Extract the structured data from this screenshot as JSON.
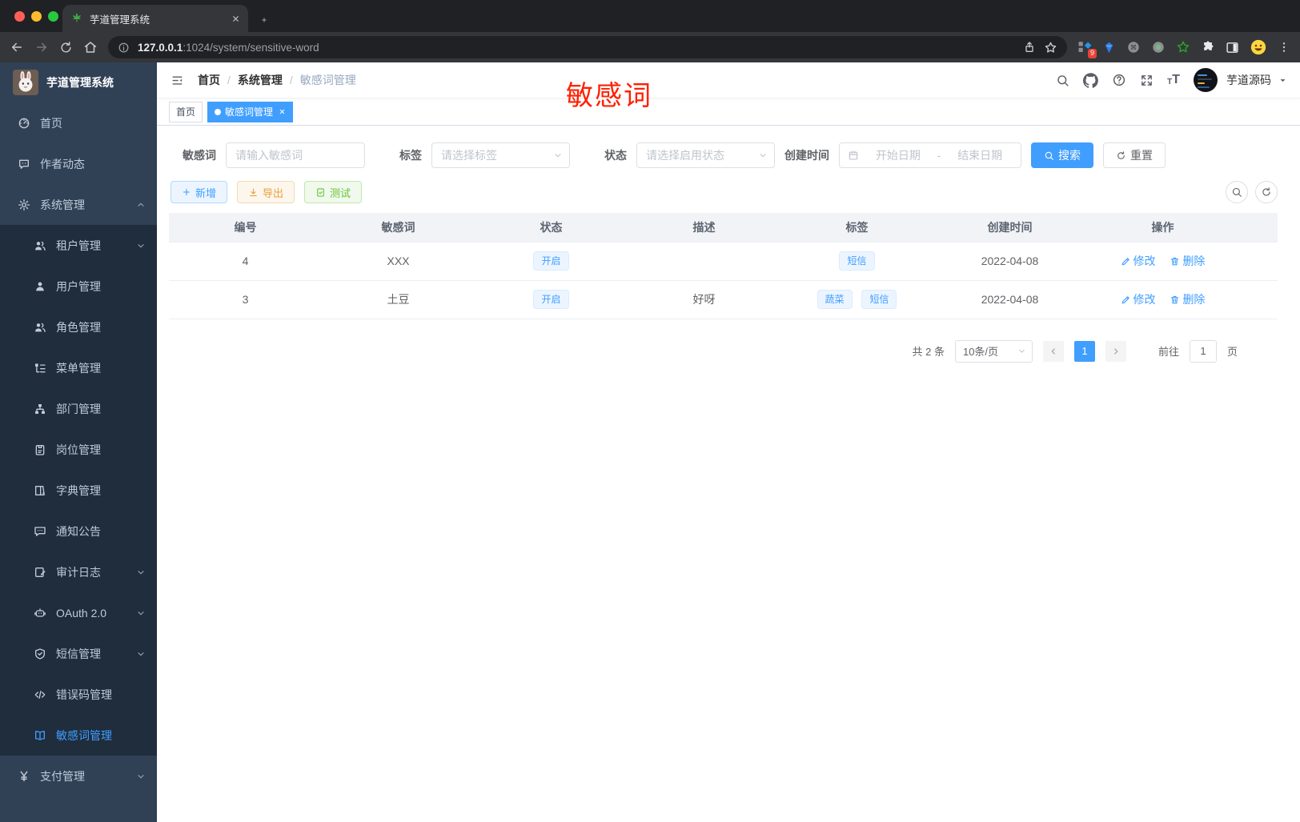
{
  "browser": {
    "tab_title": "芋道管理系统",
    "url_host": "127.0.0.1",
    "url_rest": ":1024/system/sensitive-word",
    "ext_badge": "9"
  },
  "sidebar": {
    "logo_title": "芋道管理系统",
    "items": [
      {
        "label": "首页"
      },
      {
        "label": "作者动态"
      },
      {
        "label": "系统管理"
      },
      {
        "label": "租户管理"
      },
      {
        "label": "用户管理"
      },
      {
        "label": "角色管理"
      },
      {
        "label": "菜单管理"
      },
      {
        "label": "部门管理"
      },
      {
        "label": "岗位管理"
      },
      {
        "label": "字典管理"
      },
      {
        "label": "通知公告"
      },
      {
        "label": "审计日志"
      },
      {
        "label": "OAuth 2.0"
      },
      {
        "label": "短信管理"
      },
      {
        "label": "错误码管理"
      },
      {
        "label": "敏感词管理"
      },
      {
        "label": "支付管理"
      }
    ]
  },
  "navbar": {
    "breadcrumbs": [
      "首页",
      "系统管理",
      "敏感词管理"
    ],
    "username": "芋道源码"
  },
  "tabs": [
    {
      "label": "首页"
    },
    {
      "label": "敏感词管理"
    }
  ],
  "annotation": {
    "text": "敏感词",
    "color": "#ff2000"
  },
  "filters": {
    "keyword_label": "敏感词",
    "keyword_placeholder": "请输入敏感词",
    "tag_label": "标签",
    "tag_placeholder": "请选择标签",
    "status_label": "状态",
    "status_placeholder": "请选择启用状态",
    "date_label": "创建时间",
    "date_start_placeholder": "开始日期",
    "date_sep": "-",
    "date_end_placeholder": "结束日期",
    "search_label": "搜索",
    "reset_label": "重置"
  },
  "actions": {
    "add": "新增",
    "export": "导出",
    "test": "测试"
  },
  "table": {
    "headers": [
      "编号",
      "敏感词",
      "状态",
      "描述",
      "标签",
      "创建时间",
      "操作"
    ],
    "rows": [
      {
        "id": "4",
        "word": "XXX",
        "status": "开启",
        "desc": "",
        "tags": [
          "短信"
        ],
        "created": "2022-04-08",
        "edit": "修改",
        "delete": "删除"
      },
      {
        "id": "3",
        "word": "土豆",
        "status": "开启",
        "desc": "好呀",
        "tags": [
          "蔬菜",
          "短信"
        ],
        "created": "2022-04-08",
        "edit": "修改",
        "delete": "删除"
      }
    ]
  },
  "pagination": {
    "total": "共 2 条",
    "page_size": "10条/页",
    "page": "1",
    "goto_label": "前往",
    "goto_value": "1",
    "page_label": "页"
  },
  "colors": {
    "accent": "#409eff",
    "sidebar_bg": "#304156",
    "submenu_bg": "#1f2d3d",
    "tag_bg": "#ecf5ff",
    "annotation_red": "#ff2000"
  }
}
